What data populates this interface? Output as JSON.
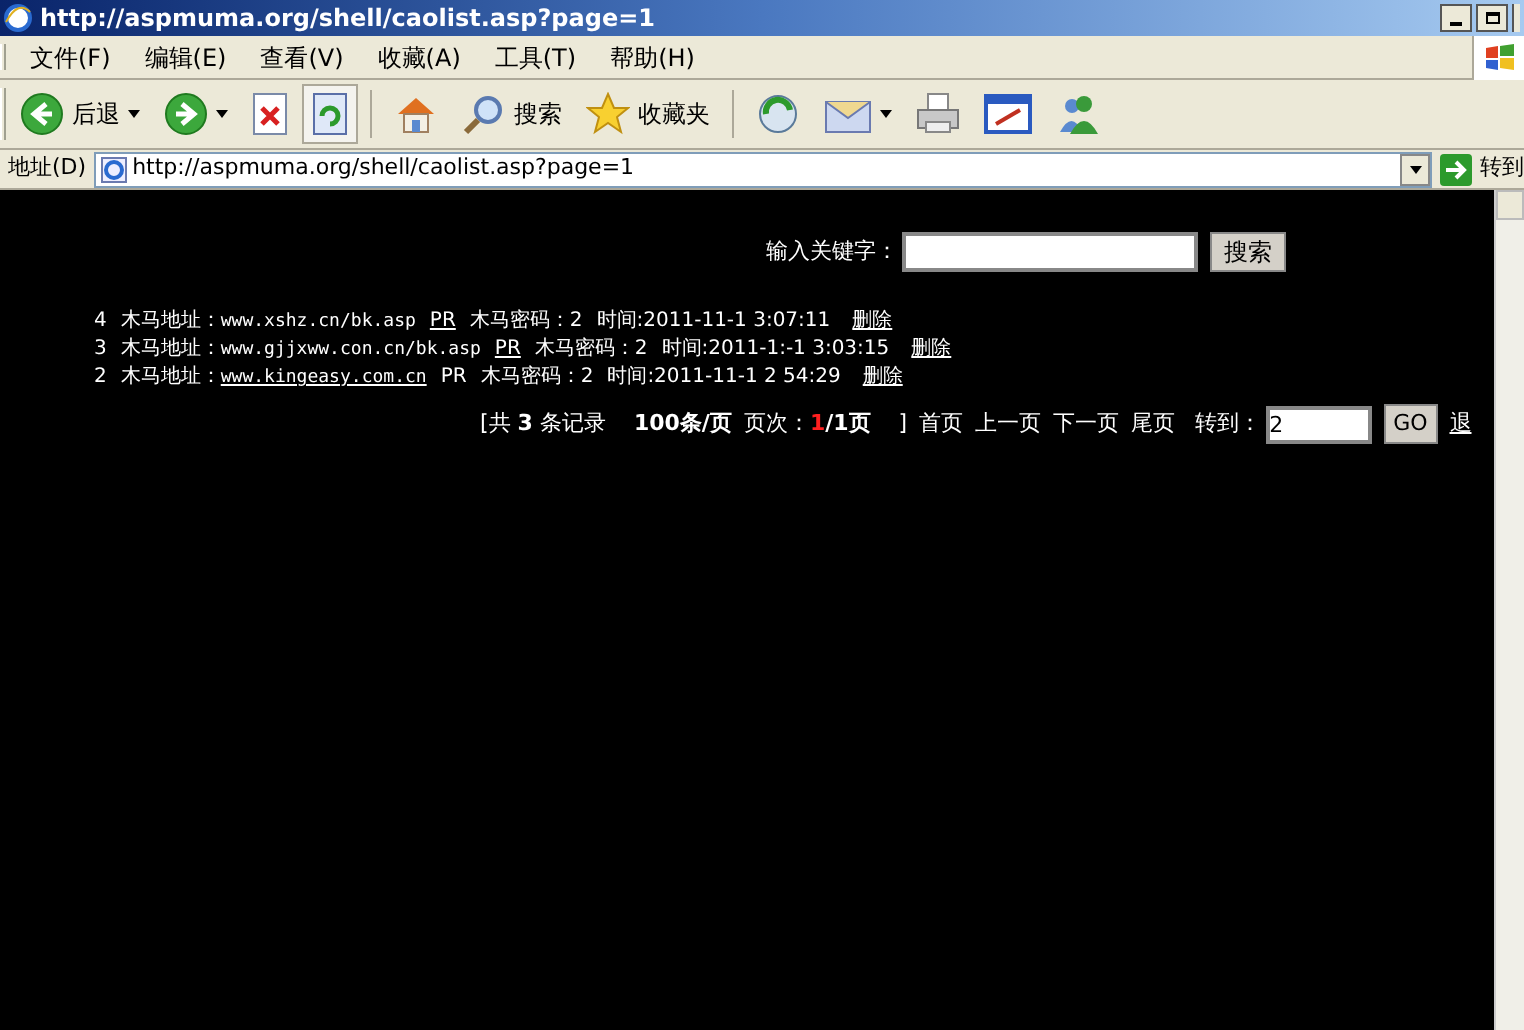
{
  "window": {
    "title": "http://aspmuma.org/shell/caolist.asp?page=1"
  },
  "menu": [
    "文件(F)",
    "编辑(E)",
    "查看(V)",
    "收藏(A)",
    "工具(T)",
    "帮助(H)"
  ],
  "toolbar": [
    {
      "kind": "back",
      "label": "后退",
      "dropdown": true,
      "pressed": false
    },
    {
      "kind": "forward",
      "dropdown": true,
      "pressed": false
    },
    {
      "kind": "stop",
      "dropdown": false,
      "pressed": false
    },
    {
      "kind": "refresh",
      "dropdown": false,
      "pressed": true
    },
    {
      "kind": "home",
      "dropdown": false,
      "pressed": false
    },
    {
      "kind": "search",
      "label": "搜索",
      "dropdown": false,
      "pressed": false
    },
    {
      "kind": "favorites",
      "label": "收藏夹",
      "dropdown": false,
      "pressed": false
    },
    {
      "kind": "media",
      "dropdown": false,
      "pressed": false
    },
    {
      "kind": "mail",
      "dropdown": true,
      "pressed": false
    },
    {
      "kind": "print",
      "dropdown": false,
      "pressed": false
    },
    {
      "kind": "edit",
      "dropdown": false,
      "pressed": false
    },
    {
      "kind": "messenger",
      "dropdown": false,
      "pressed": false
    }
  ],
  "address_bar": {
    "label": "地址(D)",
    "value": "http://aspmuma.org/shell/caolist.asp?page=1",
    "go": "转到"
  },
  "search": {
    "label": "输入关键字：",
    "button": "搜索"
  },
  "records": [
    {
      "index": "4",
      "address_label": "木马地址：",
      "url": "www.xshz.cn/bk.asp",
      "url_underlined": false,
      "pr": "PR",
      "pr_underlined": true,
      "password": "木马密码：2",
      "time": "时间:2011-11-1 3:07:11",
      "delete": "删除"
    },
    {
      "index": "3",
      "address_label": "木马地址：",
      "url": "www.gjjxww.con.cn/bk.asp",
      "url_underlined": false,
      "pr": "PR",
      "pr_underlined": true,
      "password": "木马密码：2",
      "time": "时间:2011-1:-1 3:03:15",
      "delete": "删除"
    },
    {
      "index": "2",
      "address_label": "木马地址：",
      "url": "www.kingeasy.com.cn",
      "url_underlined": true,
      "pr": "PR",
      "pr_underlined": false,
      "password": "木马密码：2",
      "time": "时间:2011-11-1 2 54:29",
      "delete": "删除"
    }
  ],
  "pager": {
    "total_prefix": "[共",
    "total": "3",
    "total_suffix": "条记录",
    "per_page": "100条/页",
    "page_label": "页次：",
    "current_page": "1",
    "page_count": "/1页",
    "close_bracket": "]",
    "links": [
      "首页",
      "上一页",
      "下一页",
      "尾页"
    ],
    "goto_label": "转到：",
    "goto_value": "2",
    "go": "GO",
    "logout": "退"
  }
}
